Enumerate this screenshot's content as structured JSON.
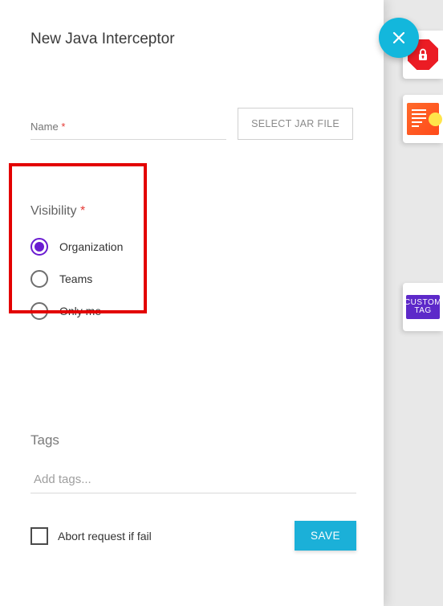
{
  "title": "New Java Interceptor",
  "name_field": {
    "label": "Name"
  },
  "jar_button": "SELECT JAR FILE",
  "visibility": {
    "title": "Visibility",
    "options": [
      {
        "label": "Organization",
        "selected": true
      },
      {
        "label": "Teams",
        "selected": false
      },
      {
        "label": "Only me",
        "selected": false
      }
    ]
  },
  "tags": {
    "title": "Tags",
    "placeholder": "Add tags..."
  },
  "abort": {
    "label": "Abort request if fail",
    "checked": false
  },
  "save": "SAVE",
  "required_marker": "*",
  "custom_tag": {
    "line1": "CUSTOM",
    "line2": "TAG"
  }
}
